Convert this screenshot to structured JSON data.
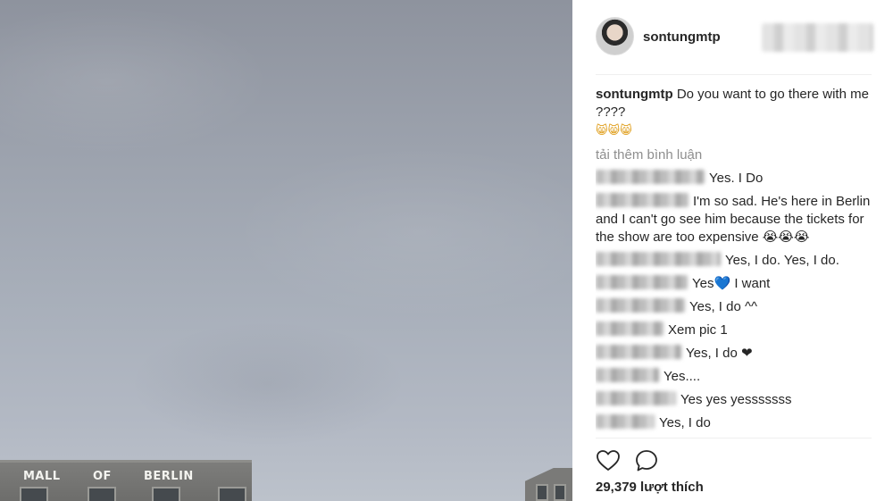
{
  "post": {
    "username": "sontungmtp",
    "caption_username": "sontungmtp",
    "caption_text": "Do you want to go there with me ????",
    "caption_emojis": "😸😸😸",
    "load_more": "tải thêm bình luận",
    "likes": "29,379 lượt thích"
  },
  "photo": {
    "sign_words": [
      "MALL",
      "OF",
      "BERLIN"
    ]
  },
  "comments": [
    {
      "text": "Yes. I Do"
    },
    {
      "text": "I'm so sad. He's here in Berlin and I can't go see him because the tickets for the show are too expensive 😭😭😭"
    },
    {
      "text": "Yes, I do. Yes, I do."
    },
    {
      "text": "Yes💙 I want"
    },
    {
      "text": "Yes, I do ^^"
    },
    {
      "text": "Xem pic 1"
    },
    {
      "text": "Yes, I do ❤"
    },
    {
      "text": "Yes...."
    },
    {
      "text": "Yes yes yesssssss"
    },
    {
      "text": "Yes, I do"
    }
  ],
  "icons": {
    "like": "heart-outline-icon",
    "comment": "speech-bubble-icon"
  }
}
